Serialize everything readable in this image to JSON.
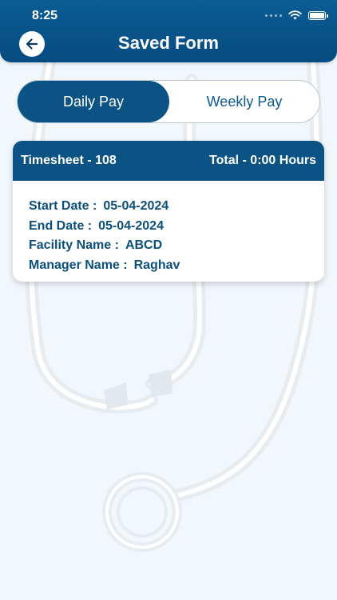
{
  "status_bar": {
    "time": "8:25"
  },
  "header": {
    "title": "Saved Form"
  },
  "tabs": [
    {
      "label": "Daily Pay",
      "active": true
    },
    {
      "label": "Weekly Pay",
      "active": false
    }
  ],
  "timesheet": {
    "title": "Timesheet - 108",
    "total": "Total - 0:00 Hours",
    "fields": [
      {
        "label": "Start Date :",
        "value": "05-04-2024"
      },
      {
        "label": "End Date :",
        "value": "05-04-2024"
      },
      {
        "label": "Facility Name :",
        "value": "ABCD"
      },
      {
        "label": "Manager Name :",
        "value": "Raghav"
      }
    ]
  },
  "colors": {
    "primary": "#0a5384",
    "header": "#0a5c94",
    "text_primary": "#0c4f7a",
    "background": "#f2f7fb"
  },
  "icons": [
    "back-arrow-icon",
    "wifi-icon",
    "battery-icon",
    "signal-dots-icon",
    "stethoscope-background"
  ]
}
